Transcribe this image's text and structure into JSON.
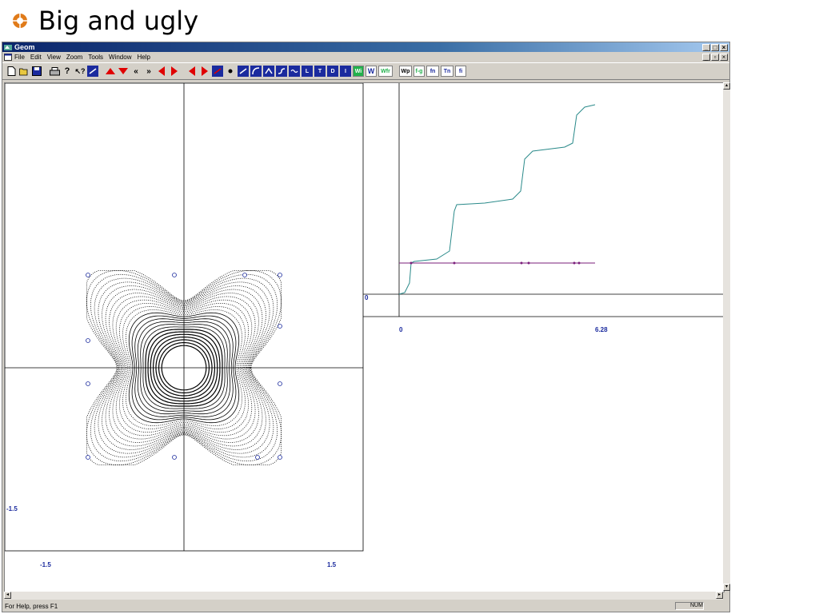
{
  "slide": {
    "title": "Big and ugly"
  },
  "window": {
    "title": "Geom",
    "menu": [
      "File",
      "Edit",
      "View",
      "Zoom",
      "Tools",
      "Window",
      "Help"
    ],
    "status": "For Help, press F1",
    "num_indicator": "NUM"
  },
  "toolbar": {
    "labels": [
      "L",
      "T",
      "D",
      "I",
      "Wi",
      "W",
      "Wfr",
      "Wp",
      "f-g",
      "fn",
      "Tn",
      "fi"
    ]
  },
  "left_plot": {
    "x_min_label": "-1.5",
    "x_max_label": "1.5",
    "y_min_label": "-1.5"
  },
  "right_plot": {
    "x_zero_label": "0",
    "x_max_label": "6.28",
    "y_zero_label": "0"
  },
  "colors": {
    "accent": "#1b2b9e",
    "curve_teal": "#2a8a8a",
    "curve_purple": "#7b1f7b",
    "title_bar": "#0a246a"
  }
}
